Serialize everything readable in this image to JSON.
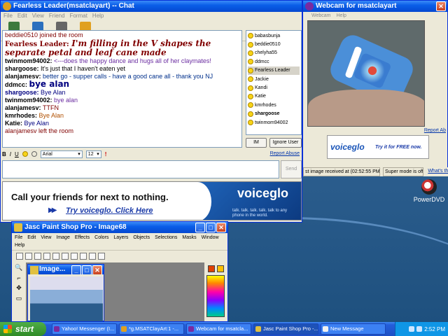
{
  "chat_window": {
    "title": "Fearless Leader(msatclayart) -- Chat",
    "menu": [
      "File",
      "Edit",
      "View",
      "Friend",
      "Format",
      "Help"
    ],
    "toolbar": [
      {
        "label": "Send File",
        "icon": "send-file-icon",
        "color": "#3d7a3d"
      },
      {
        "label": "Webcam",
        "icon": "webcam-icon",
        "color": "#2a6fbe"
      },
      {
        "label": "Voice",
        "icon": "microphone-icon",
        "color": "#666666"
      },
      {
        "label": "Chat",
        "icon": "chat-bubble-icon",
        "color": "#e0a020"
      }
    ],
    "messages": [
      {
        "name": "",
        "text": "beddie0510 joined the room",
        "name_color": "#800000",
        "text_color": "#800000"
      },
      {
        "name": "Fearless Leader:",
        "text": "I'm filling in the V shapes the separate petal and leaf cane made",
        "name_color": "#800000",
        "text_color": "#800000",
        "big": true
      },
      {
        "name": "twinmom94002:",
        "text": "<---does the happy dance and hugs all of her claymates!",
        "name_color": "#000000",
        "text_color": "#6a2ca0"
      },
      {
        "name": "shargoose:",
        "text": "It's just that I haven't eaten yet",
        "name_color": "#000000",
        "text_color": "#000000"
      },
      {
        "name": "alanjamesv:",
        "text": "better go - supper calls - have a good cane all - thank you NJ",
        "name_color": "#000000",
        "text_color": "#00308c"
      },
      {
        "name": "ddmcc:",
        "text": "bye alan",
        "name_color": "#000000",
        "text_color": "#000080",
        "big_plain": true
      },
      {
        "name": "shargoose:",
        "text": "Bye Alan",
        "name_color": "#000080",
        "text_color": "#000080"
      },
      {
        "name": "twinmom94002:",
        "text": "bye alan",
        "name_color": "#000000",
        "text_color": "#6a2ca0"
      },
      {
        "name": "alanjamesv:",
        "text": "TTFN",
        "name_color": "#000000",
        "text_color": "#800000"
      },
      {
        "name": "kmrhodes:",
        "text": "Bye Alan",
        "name_color": "#000000",
        "text_color": "#b05000"
      },
      {
        "name": "Katie:",
        "text": "Bye Alan",
        "name_color": "#000000",
        "text_color": "#000080"
      },
      {
        "name": "",
        "text": "alanjamesv left the room",
        "name_color": "#800000",
        "text_color": "#800000"
      }
    ],
    "users": [
      "babasbunja",
      "beddie0510",
      "chelyha55",
      "ddmcc",
      "Fearless Leader",
      "Jackie",
      "Kandi",
      "Katie",
      "kmrhodes",
      "shargoose",
      "twinmom94002"
    ],
    "selected_user": "Fearless Leader",
    "bold_user": "shargoose",
    "im_button": "IM",
    "ignore_button": "Ignore User",
    "format_bar": {
      "bold": "B",
      "italic": "I",
      "underline": "U",
      "font": "Arial",
      "size": "12"
    },
    "report_abuse": "Report Abuse",
    "send_button": "Send",
    "ad": {
      "headline": "Call your friends for next to nothing.",
      "cta": "Try voiceglo. Click Here",
      "logo": "voiceglo",
      "tagline": "talk. talk. talk. talk. talk to any phone in the world."
    }
  },
  "webcam_window": {
    "title": "Webcam for msatclayart",
    "menu": [
      "Webcam",
      "Help"
    ],
    "report_abuse": "Report Ab",
    "ad": {
      "logo": "voiceglo",
      "cta": "Try it for FREE now."
    },
    "status_received": "st image received at (02:52:55 PM)",
    "status_mode": "Super mode is off",
    "status_link": "What's th"
  },
  "desktop": {
    "icon_label": "PowerDVD"
  },
  "psp_window": {
    "title": "Jasc Paint Shop Pro - Image68",
    "menu": [
      "File",
      "Edit",
      "View",
      "Image",
      "Effects",
      "Colors",
      "Layers",
      "Objects",
      "Selections",
      "Masks",
      "Window",
      "Help"
    ],
    "child_title": "Image...",
    "fg_color": "#e04000",
    "bg_color": "#ffc000"
  },
  "taskbar": {
    "start": "start",
    "tasks": [
      {
        "label": "Yahoo! Messenger (I...",
        "icon_color": "#7a2aa0"
      },
      {
        "label": "*g.MSATClayArt:1 -...",
        "icon_color": "#e0a020"
      },
      {
        "label": "Webcam for msatcla...",
        "icon_color": "#7a2aa0"
      },
      {
        "label": "Jasc Paint Shop Pro -...",
        "icon_color": "#e0c040"
      },
      {
        "label": "New Message",
        "icon_color": "#f0f0f0"
      }
    ],
    "clock": "2:52 PM"
  }
}
